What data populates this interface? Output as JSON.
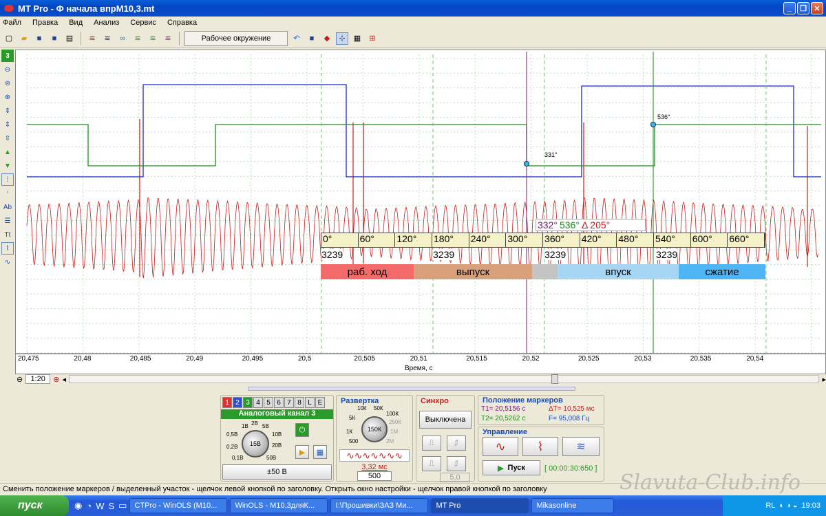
{
  "window": {
    "title": "MT Pro - Ф  начала впрМ10,3.mt",
    "min": "_",
    "max": "❐",
    "close": "✕"
  },
  "menu": [
    "Файл",
    "Правка",
    "Вид",
    "Анализ",
    "Сервис",
    "Справка"
  ],
  "toolbar": {
    "environment": "Рабочее окружение"
  },
  "channel_indicator": "3",
  "plot": {
    "x_axis_label": "Время, с",
    "x_ticks": [
      "20,475",
      "20,48",
      "20,485",
      "20,49",
      "20,495",
      "20,5",
      "20,505",
      "20,51",
      "20,515",
      "20,52",
      "20,525",
      "20,53",
      "20,535",
      "20,54"
    ],
    "marker1_label": "331°",
    "marker2_label": "536°",
    "marker_box": {
      "t1": "332°",
      "t2": "536°",
      "delta": "205°"
    },
    "degree_ticks": [
      "0°",
      "60°",
      "120°",
      "180°",
      "240°",
      "300°",
      "360°",
      "420°",
      "480°",
      "540°",
      "600°",
      "660°"
    ],
    "counts": [
      "3239",
      "3239",
      "3239",
      "3239"
    ],
    "phases": [
      {
        "label": "раб. ход",
        "color": "#f46a6a",
        "width": 135
      },
      {
        "label": "выпуск",
        "color": "#d9a07c",
        "width": 172
      },
      {
        "label": "",
        "color": "#c4c4c4",
        "width": 37
      },
      {
        "label": "впуск",
        "color": "#a6d6f4",
        "width": 176
      },
      {
        "label": "сжатие",
        "color": "#4eb6f4",
        "width": 126
      }
    ],
    "colors": {
      "red": "#cc1a1a",
      "blue": "#1a2ac8",
      "green": "#1a8a1a",
      "purple": "#7a1a7a"
    }
  },
  "zoom": {
    "value": "1:20"
  },
  "channel_panel": {
    "tabs": [
      "1",
      "2",
      "3",
      "4",
      "5",
      "6",
      "7",
      "8",
      "L",
      "E"
    ],
    "title": "Аналоговый канал 3",
    "knob": "15В",
    "ticks": [
      "1В",
      "2В",
      "5В",
      "10В",
      "20В",
      "50В",
      "0,5В",
      "0,2В",
      "0,1В"
    ],
    "range": "±50 В"
  },
  "sweep_panel": {
    "title": "Развертка",
    "knob": "150К",
    "ticks": [
      "10К",
      "50К",
      "5К",
      "100К",
      "250К",
      "1К",
      "1М",
      "500",
      "2М"
    ],
    "period": "3,32 мс",
    "count": "500"
  },
  "sync_panel": {
    "title": "Синхро",
    "mode": "Выключена",
    "level": "5,0"
  },
  "markers_panel": {
    "title": "Положение маркеров",
    "t1": "T1= 20,5156 с",
    "dt": "ΔT= 10,525 мс",
    "t2": "T2= 20,5262 с",
    "f": "F= 95,008 Гц"
  },
  "control_panel": {
    "title": "Управление",
    "start": "Пуск",
    "elapsed": "[ 00:00:30:650 ]"
  },
  "status": "Сменить положение маркеров / выделенный участок - щелчок левой кнопкой по заголовку. Открыть окно настройки - щелчок правой кнопкой по заголовку",
  "watermark": "Slavuta-Club.info",
  "taskbar": {
    "start": "пуск",
    "tasks": [
      "CTPro - WinOLS (M10...",
      "WinOLS - M10,3дляК...",
      "I:\\Прошивки\\ЗАЗ Ми...",
      "MT Pro",
      "Mikasonline"
    ],
    "lang": "RL",
    "clock": "19:03"
  }
}
